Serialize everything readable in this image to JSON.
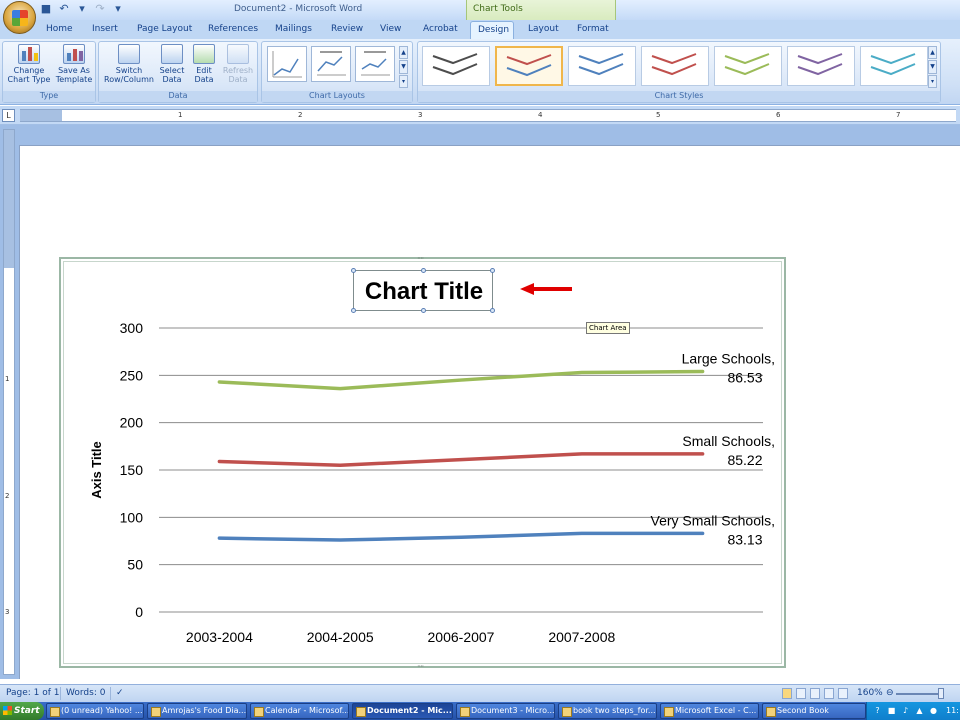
{
  "window": {
    "title": "Document2 - Microsoft Word",
    "contextual_tab_group": "Chart Tools"
  },
  "tabs": [
    "Home",
    "Insert",
    "Page Layout",
    "References",
    "Mailings",
    "Review",
    "View",
    "Acrobat",
    "Design",
    "Layout",
    "Format"
  ],
  "active_tab": "Design",
  "ribbon": {
    "groups": {
      "type": "Type",
      "data": "Data",
      "chart_layouts": "Chart Layouts",
      "chart_styles": "Chart Styles"
    },
    "buttons": {
      "change_chart_type": [
        "Change",
        "Chart Type"
      ],
      "save_as_template": [
        "Save As",
        "Template"
      ],
      "switch_row_column": [
        "Switch",
        "Row/Column"
      ],
      "select_data": [
        "Select",
        "Data"
      ],
      "edit_data": [
        "Edit",
        "Data"
      ],
      "refresh_data": [
        "Refresh",
        "Data"
      ]
    },
    "style_colors": [
      "#4d4d4d",
      "#4f81bd",
      "#4f81bd",
      "#c0504d",
      "#9bbb59",
      "#8064a2",
      "#4bacc6"
    ],
    "style_colors_second": [
      "#4d4d4d",
      "#c0504d",
      "#4f81bd",
      "#c0504d",
      "#9bbb59",
      "#8064a2",
      "#4bacc6"
    ]
  },
  "ruler": {
    "numbers": [
      "1",
      "2",
      "3",
      "4",
      "5",
      "6",
      "7"
    ],
    "vertical_numbers": [
      "1",
      "2",
      "3"
    ]
  },
  "chart": {
    "title": "Chart Title",
    "y_axis_title": "Axis Title",
    "tooltip": "Chart Area",
    "accent_arrow_color": "#e00000"
  },
  "chart_data": {
    "type": "line",
    "title": "Chart Title",
    "xlabel": "",
    "ylabel": "Axis Title",
    "categories": [
      "2003-2004",
      "2004-2005",
      "2006-2007",
      "2007-2008",
      ""
    ],
    "ylim": [
      0,
      300
    ],
    "yticks": [
      0,
      50,
      100,
      150,
      200,
      250,
      300
    ],
    "grid": true,
    "series": [
      {
        "color": "#9bbb59",
        "values": [
          243,
          236,
          245,
          253,
          254
        ],
        "label": [
          "Large Schools,",
          "86.53"
        ]
      },
      {
        "color": "#c0504d",
        "values": [
          159,
          155,
          161,
          167,
          167
        ],
        "label": [
          "Small Schools,",
          "85.22"
        ]
      },
      {
        "color": "#4f81bd",
        "values": [
          78,
          76,
          79,
          83,
          83
        ],
        "label": [
          "Very Small Schools,",
          "83.13"
        ]
      }
    ]
  },
  "statusbar": {
    "page": "Page: 1 of 1",
    "words": "Words: 0",
    "zoom": "160%"
  },
  "taskbar": {
    "start": "Start",
    "items": [
      {
        "label": "(0 unread) Yahoo! ...",
        "active": false
      },
      {
        "label": "Amrojas's Food Dia...",
        "active": false
      },
      {
        "label": "Calendar - Microsof...",
        "active": false
      },
      {
        "label": "Document2 - Mic...",
        "active": true
      },
      {
        "label": "Document3 - Micro...",
        "active": false
      },
      {
        "label": "book two steps_for...",
        "active": false
      },
      {
        "label": "Microsoft Excel - C...",
        "active": false
      },
      {
        "label": "Second Book",
        "active": false
      }
    ],
    "clock": "11:"
  }
}
